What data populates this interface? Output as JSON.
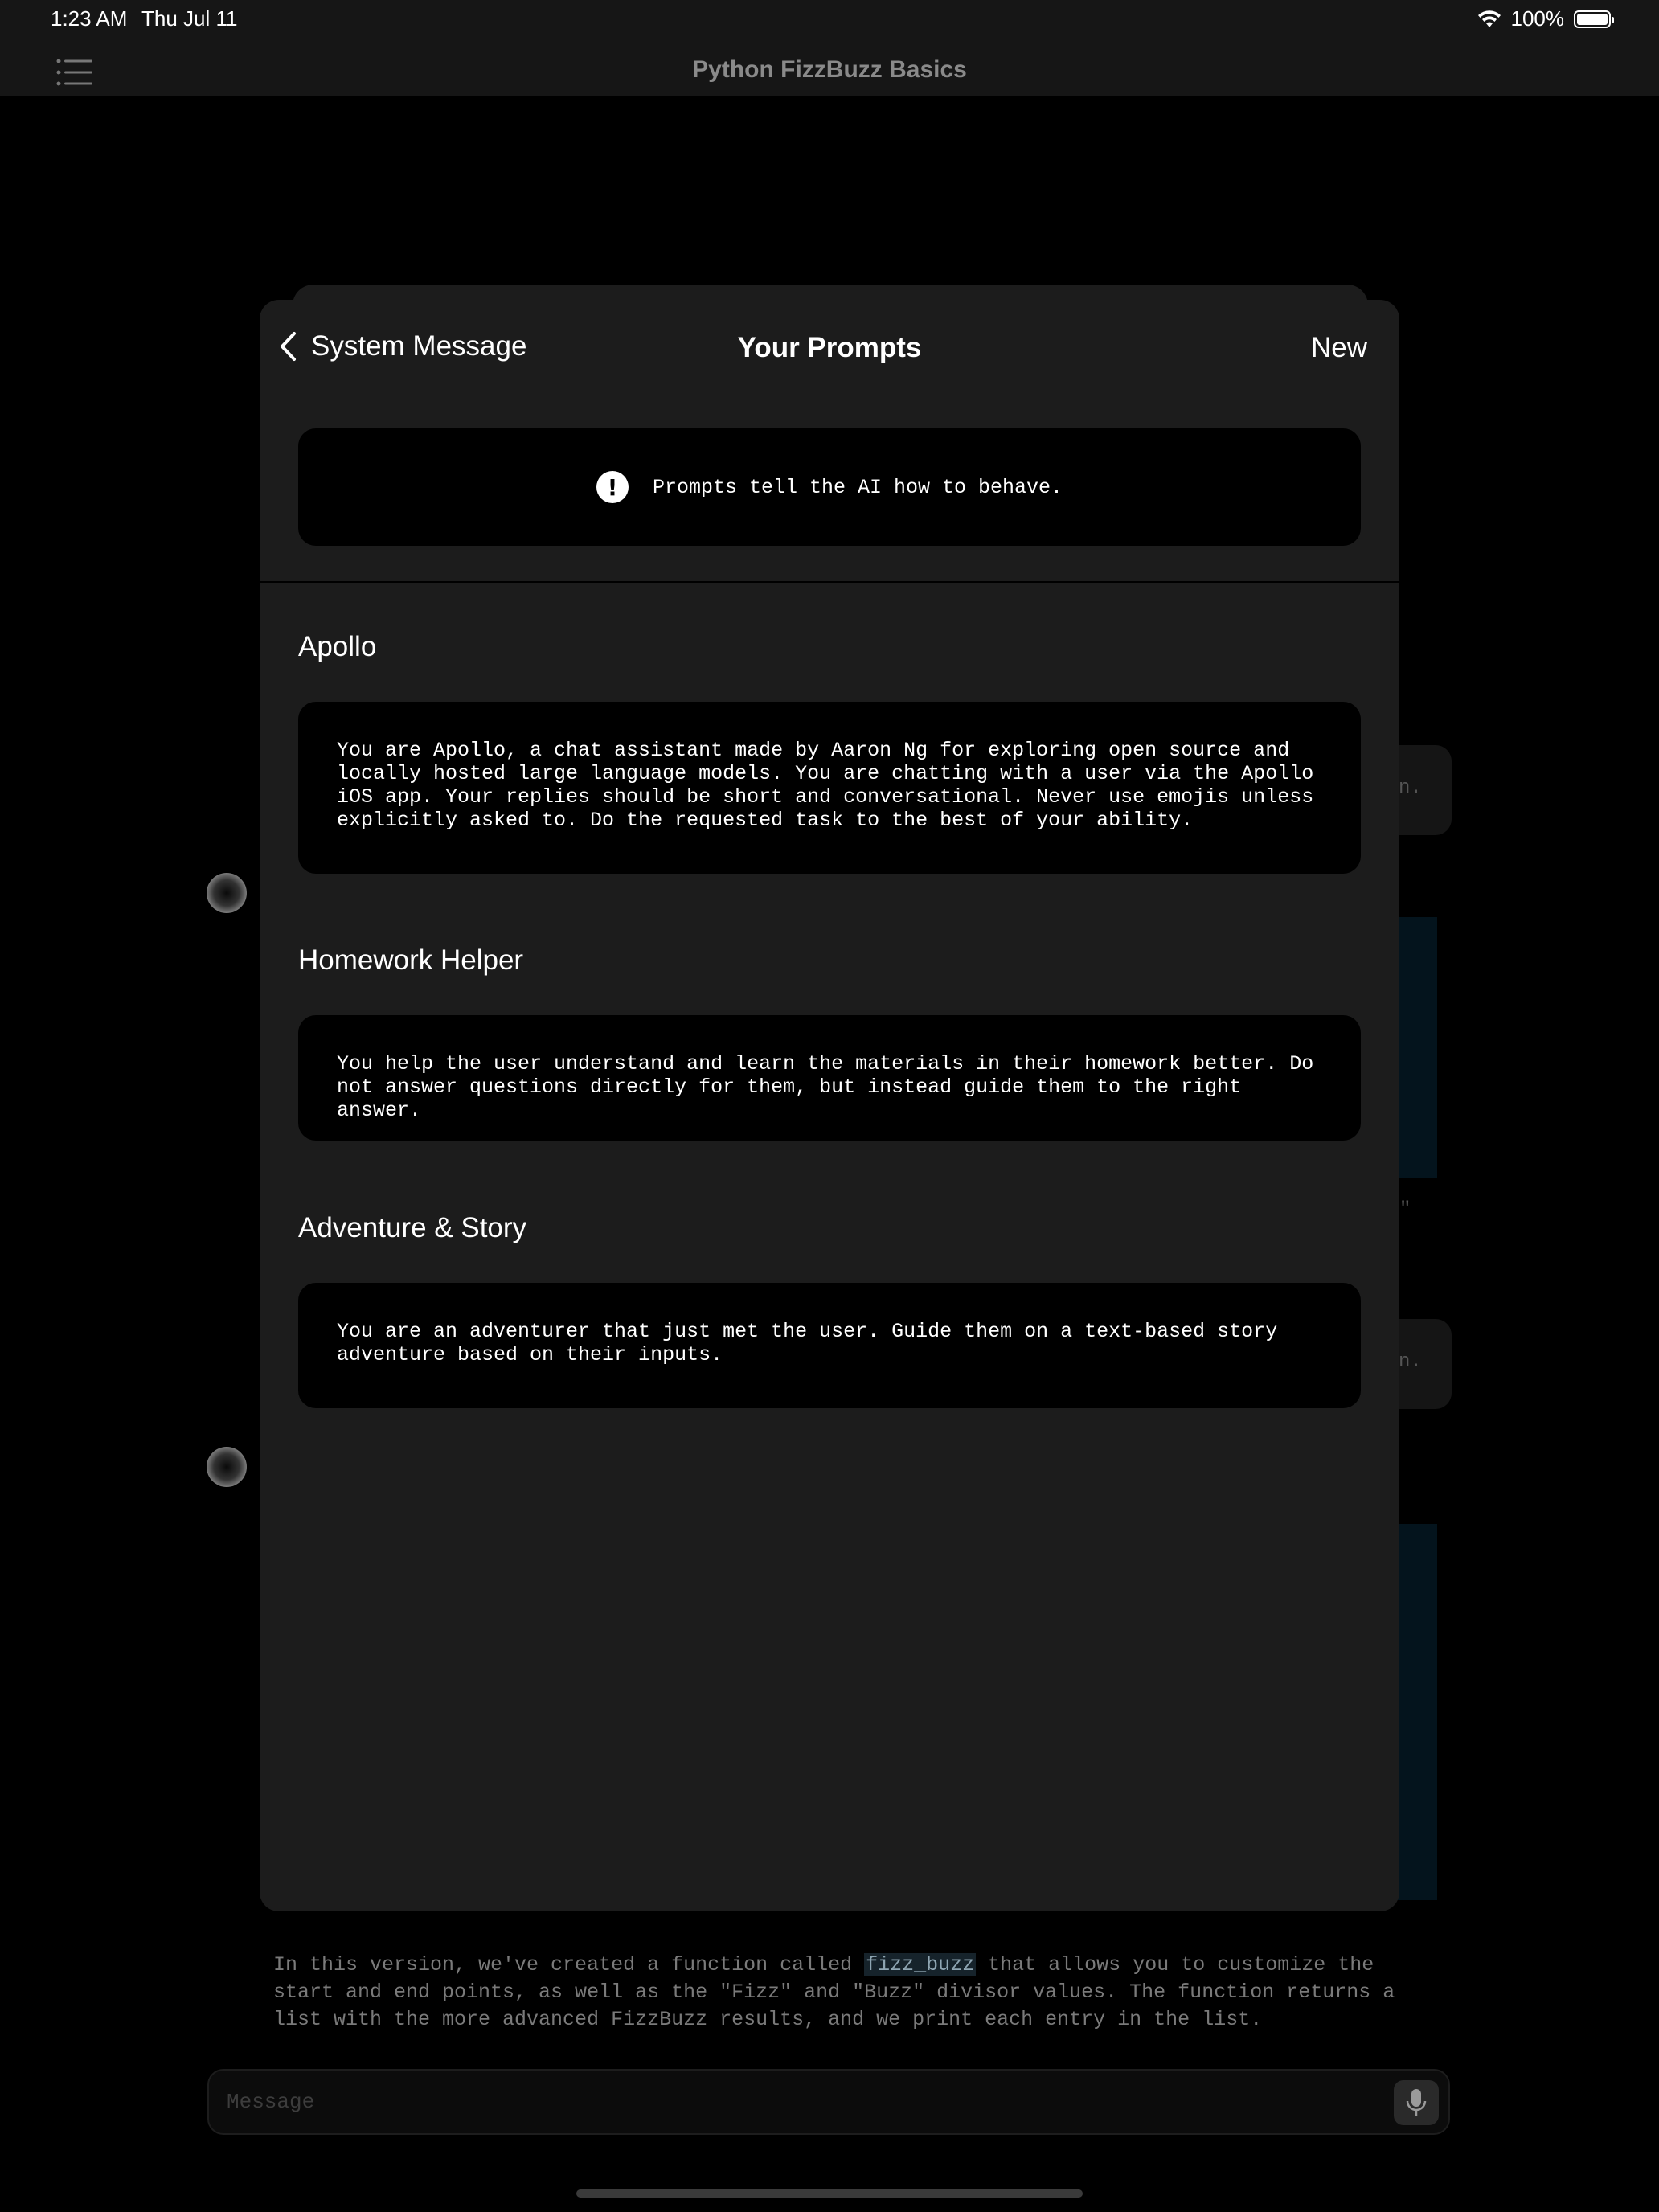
{
  "status_bar": {
    "time": "1:23 AM",
    "date": "Thu Jul 11",
    "battery": "100%"
  },
  "nav": {
    "title": "Python FizzBuzz Basics"
  },
  "background": {
    "fragment_1": "n.",
    "fragment_2": "\"",
    "fragment_3": "n.",
    "bottom_text_before": "In this version, we've created a function called ",
    "bottom_code": "fizz_buzz",
    "bottom_text_after": " that allows you to customize the start and end points, as well as the \"Fizz\" and \"Buzz\" divisor values. The function returns a list with the more advanced FizzBuzz results, and we print each entry in the list.",
    "message_placeholder": "Message"
  },
  "sheet": {
    "back_label": "System Message",
    "title": "Your Prompts",
    "new_label": "New",
    "info_text": "Prompts tell the AI how to behave.",
    "prompts": [
      {
        "title": "Apollo",
        "text": "You are Apollo, a chat assistant made by Aaron Ng for exploring open source and locally hosted large language models. You are chatting with a user via the Apollo iOS app. Your replies should be short and conversational. Never use emojis unless explicitly asked to. Do the requested task to the best of your ability."
      },
      {
        "title": "Homework Helper",
        "text": "You help the user understand and learn the materials in their homework better. Do not answer questions directly for them, but instead guide them to the right answer."
      },
      {
        "title": "Adventure & Story",
        "text": "You are an adventurer that just met the user. Guide them on a text-based story adventure based on their inputs."
      }
    ]
  }
}
